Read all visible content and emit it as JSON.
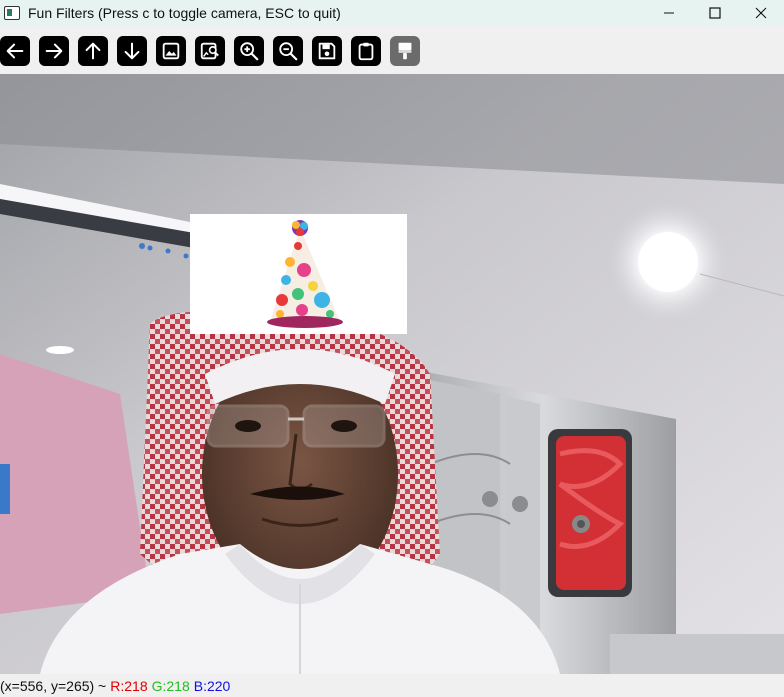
{
  "window": {
    "title": "Fun Filters (Press c to toggle camera, ESC to quit)",
    "minimize_icon": "minimize-icon",
    "maximize_icon": "maximize-icon",
    "close_icon": "close-icon"
  },
  "toolbar": {
    "buttons": [
      {
        "name": "pan-left-button",
        "icon": "arrow-left-icon"
      },
      {
        "name": "pan-right-button",
        "icon": "arrow-right-icon"
      },
      {
        "name": "pan-up-button",
        "icon": "arrow-up-icon"
      },
      {
        "name": "pan-down-button",
        "icon": "arrow-down-icon"
      },
      {
        "name": "zoom-fit-button",
        "icon": "image-icon"
      },
      {
        "name": "zoom-original-button",
        "icon": "image-zoom-icon"
      },
      {
        "name": "zoom-in-button",
        "icon": "zoom-in-icon"
      },
      {
        "name": "zoom-out-button",
        "icon": "zoom-out-icon"
      },
      {
        "name": "save-button",
        "icon": "save-icon"
      },
      {
        "name": "copy-clipboard-button",
        "icon": "clipboard-icon"
      },
      {
        "name": "properties-button",
        "icon": "brush-icon",
        "disabled": true
      }
    ]
  },
  "canvas": {
    "content": "webcam-feed",
    "overlay": "party-hat-icon"
  },
  "status": {
    "coords": "(x=556, y=265) ~",
    "r": "R:218",
    "g": "G:218",
    "b": "B:220"
  },
  "colors": {
    "titlebar": "#e6f3f1",
    "toolbar_button": "#000000",
    "status_r": "#e00000",
    "status_g": "#1fbf1f",
    "status_b": "#1010ee"
  }
}
